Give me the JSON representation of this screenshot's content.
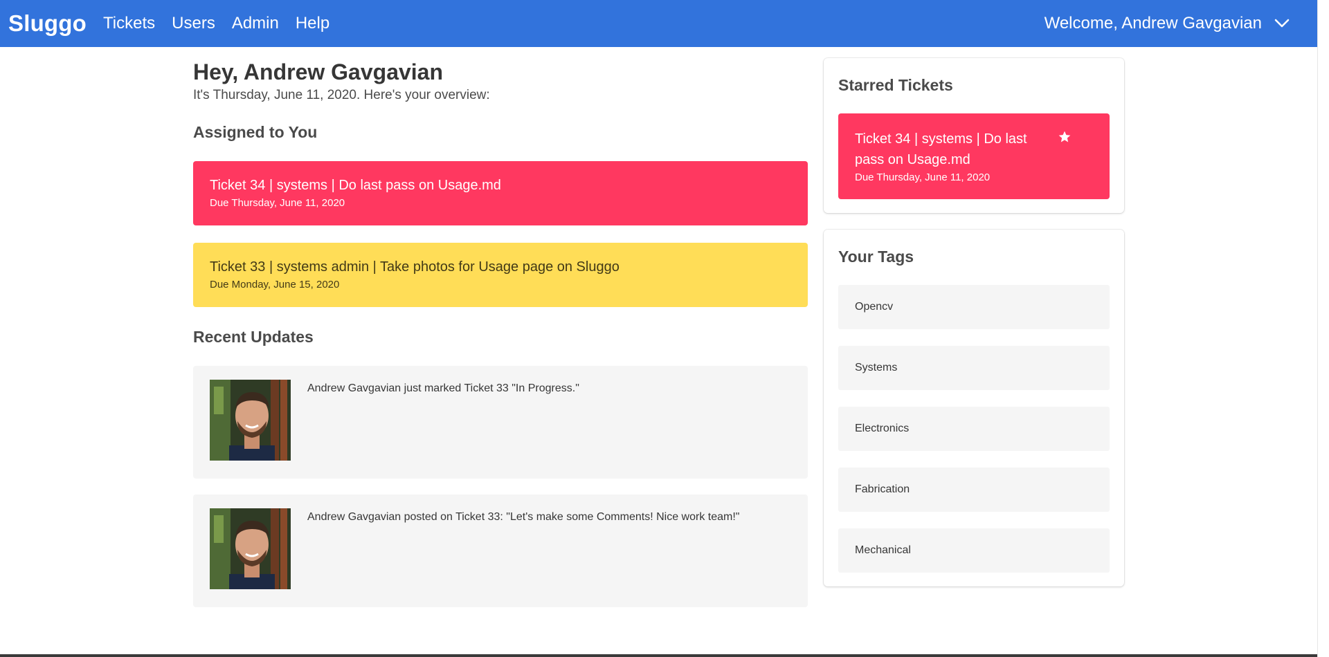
{
  "navbar": {
    "brand": "Sluggo",
    "links": [
      "Tickets",
      "Users",
      "Admin",
      "Help"
    ],
    "welcome": "Welcome, Andrew Gavgavian",
    "menu_icon": "chevron-down-icon"
  },
  "overview": {
    "greeting": "Hey, Andrew Gavgavian",
    "subtitle": "It's Thursday, June 11, 2020. Here's your overview:"
  },
  "assigned": {
    "title": "Assigned to You",
    "tickets": [
      {
        "title": "Ticket 34 | systems | Do last pass on Usage.md",
        "due": "Due Thursday, June 11, 2020",
        "color": "#ff3860"
      },
      {
        "title": "Ticket 33 | systems admin | Take photos for Usage page on Sluggo",
        "due": "Due Monday, June 15, 2020",
        "color": "#ffdd57"
      }
    ]
  },
  "updates": {
    "title": "Recent Updates",
    "items": [
      {
        "text": "Andrew Gavgavian just marked Ticket 33 \"In Progress.\""
      },
      {
        "text": "Andrew Gavgavian posted on Ticket 33: \"Let's make some Comments! Nice work team!\""
      }
    ]
  },
  "starred": {
    "title": "Starred Tickets",
    "ticket": {
      "title": "Ticket 34 | systems | Do last pass on Usage.md",
      "due": "Due Thursday, June 11, 2020",
      "icon": "star-icon"
    }
  },
  "tags": {
    "title": "Your Tags",
    "items": [
      "Opencv",
      "Systems",
      "Electronics",
      "Fabrication",
      "Mechanical"
    ]
  },
  "colors": {
    "primary": "#3273dc",
    "danger": "#ff3860",
    "warning": "#ffdd57",
    "light": "#f5f5f5"
  }
}
